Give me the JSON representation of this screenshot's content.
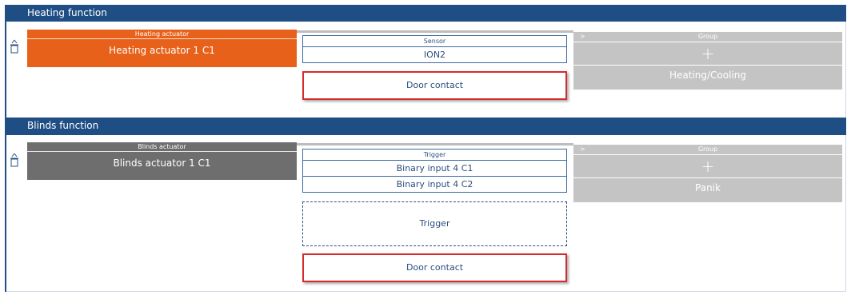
{
  "sections": [
    {
      "title": "Heating function",
      "actuator": {
        "caption": "Heating actuator",
        "name": "Heating actuator 1 C1"
      },
      "input": {
        "caption": "Sensor",
        "items": [
          "ION2"
        ]
      },
      "door_contact": "Door contact",
      "group": {
        "chevron": ">",
        "caption": "Group",
        "plus": "+",
        "name": "Heating/Cooling"
      }
    },
    {
      "title": "Blinds function",
      "actuator": {
        "caption": "Blinds actuator",
        "name": "Blinds actuator 1 C1"
      },
      "input": {
        "caption": "Trigger",
        "items": [
          "Binary input 4 C1",
          "Binary input 4 C2"
        ]
      },
      "trigger_slot": "Trigger",
      "door_contact": "Door contact",
      "group": {
        "chevron": ">",
        "caption": "Group",
        "plus": "+",
        "name": "Panik"
      }
    }
  ],
  "colors": {
    "header": "#1f4e85",
    "heating_actuator": "#e8611a",
    "blinds_actuator": "#6e6e6e",
    "group": "#c4c4c4",
    "highlight": "#d52b2b"
  },
  "icons": {
    "delete": "trash-icon"
  }
}
